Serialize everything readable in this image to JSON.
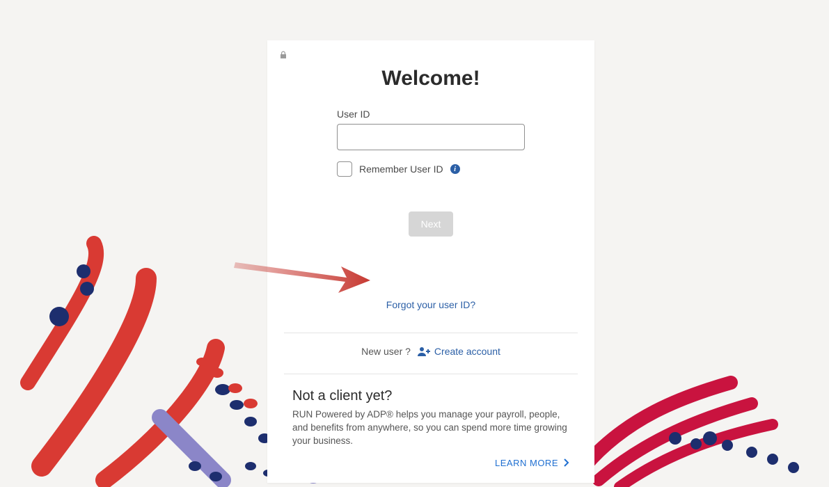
{
  "title": "Welcome!",
  "form": {
    "userid_label": "User ID",
    "userid_value": "",
    "remember_label": "Remember User ID",
    "next_label": "Next"
  },
  "links": {
    "forgot": "Forgot your user ID?",
    "newuser_text": "New user ?",
    "create_account": "Create account",
    "learn_more": "LEARN MORE"
  },
  "promo": {
    "title": "Not a client yet?",
    "body": "RUN Powered by ADP® helps you manage your payroll, people, and benefits from anywhere, so you can spend more time growing your business."
  },
  "icons": {
    "lock": "lock-icon",
    "info": "info-icon",
    "user_plus": "user-plus-icon",
    "chevron_right": "chevron-right-icon"
  },
  "annotation": {
    "highlight_color": "#e815c1",
    "arrow_color": "#c73a33"
  }
}
